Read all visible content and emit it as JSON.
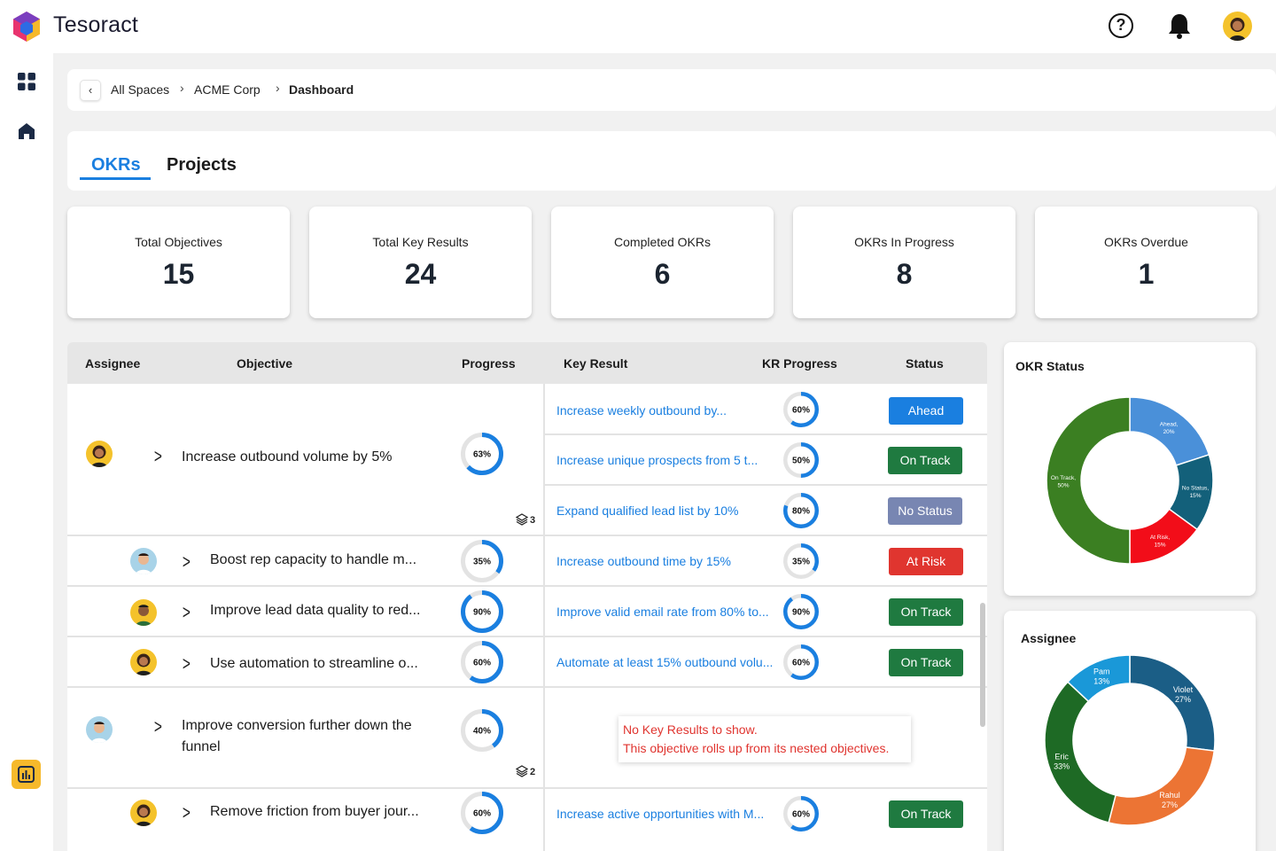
{
  "app": {
    "brand": "Tesoract"
  },
  "header": {
    "help_icon": "?",
    "notifications_icon": "bell-icon"
  },
  "breadcrumb": {
    "items": [
      "All Spaces",
      "ACME Corp",
      "Dashboard"
    ]
  },
  "tabs": [
    {
      "label": "OKRs",
      "active": true
    },
    {
      "label": "Projects",
      "active": false
    }
  ],
  "stats": [
    {
      "label": "Total Objectives",
      "value": "15"
    },
    {
      "label": "Total Key Results",
      "value": "24"
    },
    {
      "label": "Completed OKRs",
      "value": "6"
    },
    {
      "label": "OKRs In Progress",
      "value": "8"
    },
    {
      "label": "OKRs Overdue",
      "value": "1"
    }
  ],
  "table": {
    "headers": {
      "assignee": "Assignee",
      "objective": "Objective",
      "progress": "Progress",
      "key_result": "Key Result",
      "kr_progress": "KR Progress",
      "status": "Status"
    },
    "objectives": [
      {
        "title": "Increase outbound volume by 5%",
        "progress": 63,
        "progress_label": "63%",
        "nested_count": "3"
      },
      {
        "title": "Boost rep capacity to handle m...",
        "progress": 35,
        "progress_label": "35%"
      },
      {
        "title": "Improve lead data quality to red...",
        "progress": 90,
        "progress_label": "90%"
      },
      {
        "title": "Use automation to streamline o...",
        "progress": 60,
        "progress_label": "60%"
      },
      {
        "title": "Improve conversion further down the funnel",
        "progress": 40,
        "progress_label": "40%",
        "nested_count": "2"
      },
      {
        "title": "Remove friction from buyer jour...",
        "progress": 60,
        "progress_label": "60%"
      }
    ],
    "key_results": [
      {
        "title": "Increase weekly outbound by...",
        "progress": 60,
        "progress_label": "60%",
        "status": "Ahead"
      },
      {
        "title": "Increase unique prospects from 5 t...",
        "progress": 50,
        "progress_label": "50%",
        "status": "On Track"
      },
      {
        "title": "Expand qualified lead list by 10%",
        "progress": 80,
        "progress_label": "80%",
        "status": "No Status"
      },
      {
        "title": "Increase outbound time by 15%",
        "progress": 35,
        "progress_label": "35%",
        "status": "At Risk"
      },
      {
        "title": "Improve valid email rate from 80% to...",
        "progress": 90,
        "progress_label": "90%",
        "status": "On Track"
      },
      {
        "title": "Automate at least 15% outbound volu...",
        "progress": 60,
        "progress_label": "60%",
        "status": "On Track"
      },
      {
        "title": "Increase active opportunities with M...",
        "progress": 60,
        "progress_label": "60%",
        "status": "On Track"
      }
    ],
    "empty_message": {
      "line1": "No Key Results to show.",
      "line2": "This objective rolls up from its nested objectives."
    }
  },
  "status_colors": {
    "Ahead": "#1a7fe0",
    "On Track": "#1f7a40",
    "No Status": "#7886b2",
    "At Risk": "#e0352f"
  },
  "okr_status_chart": {
    "title": "OKR Status",
    "slices": [
      {
        "label": "Ahead,",
        "pct": "20%",
        "value": 20,
        "color": "#4a90d9"
      },
      {
        "label": "No Status,",
        "pct": "15%",
        "value": 15,
        "color": "#13607a"
      },
      {
        "label": "At Risk,",
        "pct": "15%",
        "value": 15,
        "color": "#f20d19"
      },
      {
        "label": "On Track,",
        "pct": "50%",
        "value": 50,
        "color": "#3b7f22"
      }
    ]
  },
  "assignee_chart": {
    "title": "Assignee",
    "slices": [
      {
        "label": "Violet",
        "pct": "27%",
        "value": 27,
        "color": "#1b5e86"
      },
      {
        "label": "Rahul",
        "pct": "27%",
        "value": 27,
        "color": "#ec7434"
      },
      {
        "label": "Eric",
        "pct": "33%",
        "value": 33,
        "color": "#1e6a25"
      },
      {
        "label": "Pam",
        "pct": "13%",
        "value": 13,
        "color": "#1a98d8"
      }
    ]
  }
}
